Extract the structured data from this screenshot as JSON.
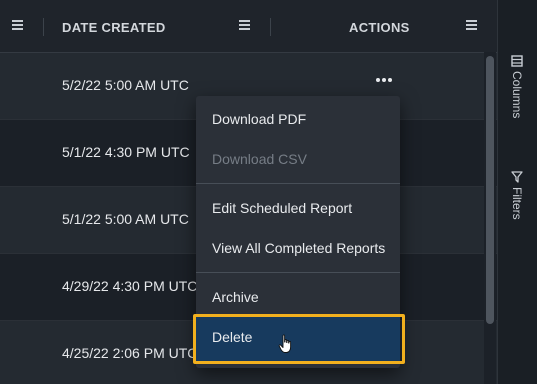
{
  "header": {
    "date_created_label": "DATE CREATED",
    "actions_label": "ACTIONS"
  },
  "rows": [
    {
      "date": "5/2/22 5:00 AM UTC"
    },
    {
      "date": "5/1/22 4:30 PM UTC"
    },
    {
      "date": "5/1/22 5:00 AM UTC"
    },
    {
      "date": "4/29/22 4:30 PM UTC"
    },
    {
      "date": "4/25/22 2:06 PM UTC"
    }
  ],
  "side_panel": {
    "columns_label": "Columns",
    "filters_label": "Filters"
  },
  "menu": {
    "download_pdf": "Download PDF",
    "download_csv": "Download CSV",
    "edit_scheduled_report": "Edit Scheduled Report",
    "view_all_completed_reports": "View All Completed Reports",
    "archive": "Archive",
    "delete": "Delete"
  },
  "colors": {
    "highlight": "#f2b01e",
    "active_item": "#173a5e"
  }
}
